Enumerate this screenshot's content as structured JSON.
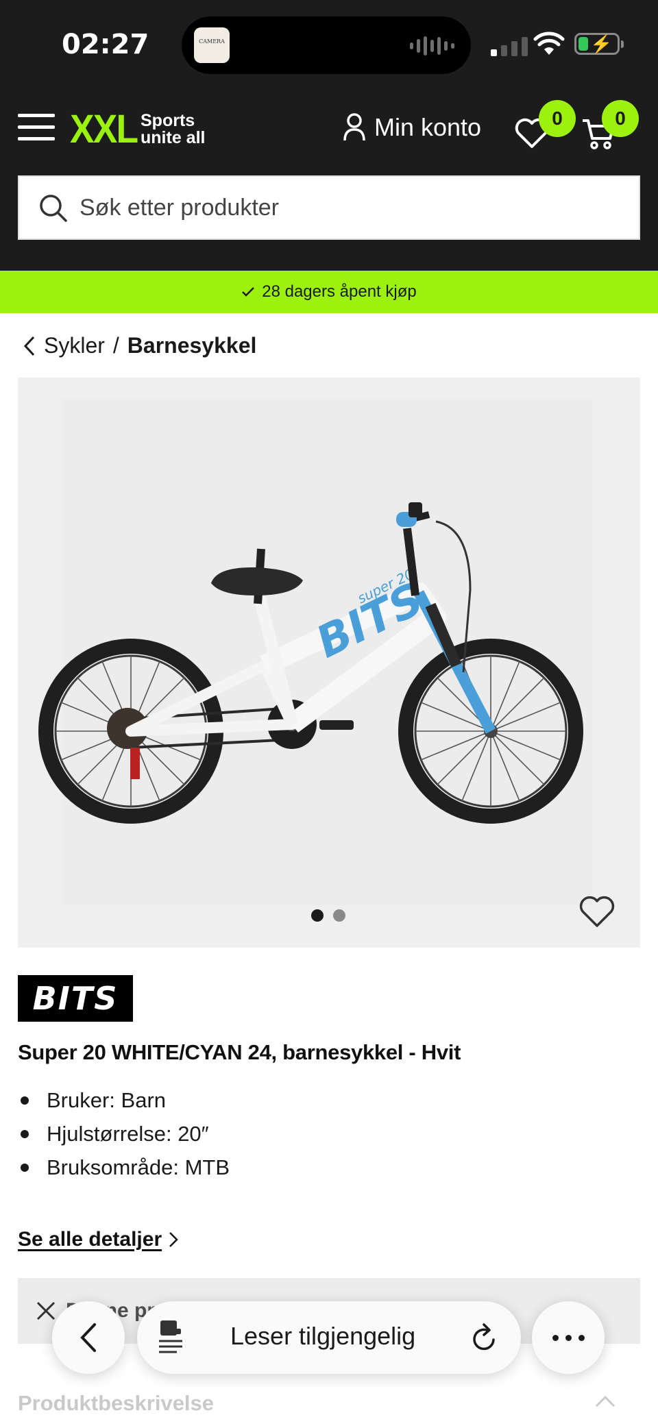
{
  "status_bar": {
    "time": "02:27",
    "dynamic_island_app_label": "CAMERA",
    "battery_color": "#35c759"
  },
  "header": {
    "logo_text": "XXL",
    "tagline_line1": "Sports",
    "tagline_line2": "unite all",
    "account_label": "Min konto",
    "wishlist_count": "0",
    "cart_count": "0",
    "brand_color": "#9cf20e",
    "background_color": "#1c1c1c",
    "icons": [
      "menu-icon",
      "user-icon",
      "heart-icon",
      "cart-icon",
      "search-icon"
    ]
  },
  "search": {
    "placeholder": "Søk etter produkter"
  },
  "promo_banner": {
    "text": "28 dagers åpent kjøp",
    "icon": "check-icon"
  },
  "breadcrumb": {
    "parent": "Sykler",
    "separator": "/",
    "current": "Barnesykkel"
  },
  "gallery": {
    "image_count": 2,
    "active_index": 0,
    "frame_lettering": [
      "super 20",
      "BITS"
    ]
  },
  "product": {
    "brand_logo_text": "BITS",
    "title": "Super 20 WHITE/CYAN 24, barnesykkel - Hvit",
    "specs": [
      "Bruker: Barn",
      "Hjulstørrelse: 20″",
      "Bruksområde: MTB"
    ],
    "details_link": "Se alle detaljer"
  },
  "notice": {
    "text": "Denne pro"
  },
  "description_section": {
    "title": "Produktbeskrivelse"
  },
  "browser_toolbar": {
    "reader_label": "Leser tilgjengelig",
    "icons": [
      "back-icon",
      "reader-icon",
      "reload-icon",
      "more-icon"
    ]
  }
}
